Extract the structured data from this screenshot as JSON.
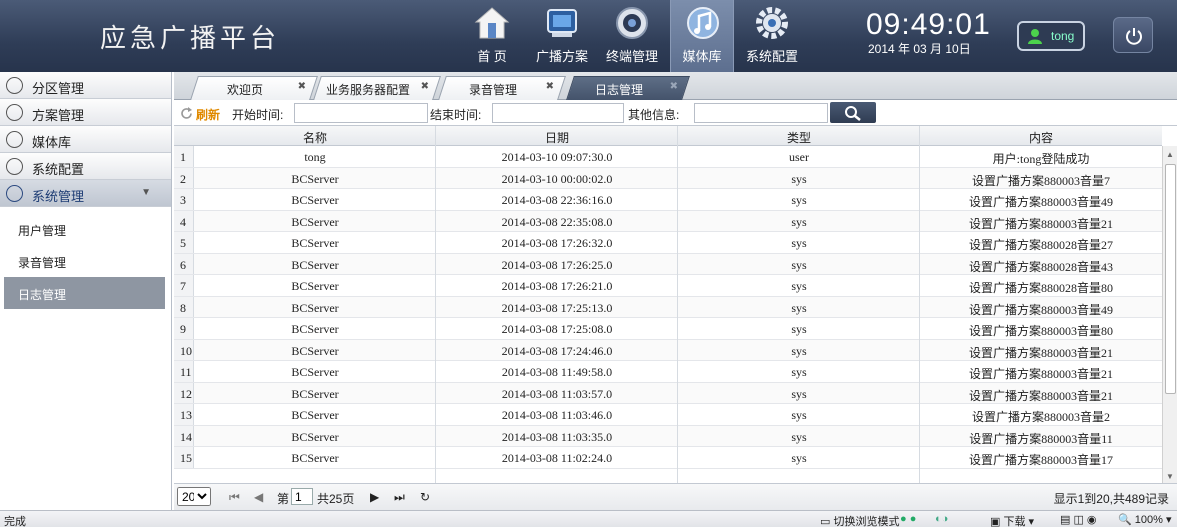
{
  "app": {
    "title": "应急广播平台"
  },
  "nav": [
    {
      "label": "首  页",
      "icon": "home-icon"
    },
    {
      "label": "广播方案",
      "icon": "broadcast-plan-icon"
    },
    {
      "label": "终端管理",
      "icon": "terminal-icon"
    },
    {
      "label": "媒体库",
      "icon": "media-library-icon",
      "active": true
    },
    {
      "label": "系统配置",
      "icon": "settings-gear-icon"
    }
  ],
  "clock": {
    "time": "09:49:01",
    "date": "2014 年 03 月 10日"
  },
  "user": {
    "name": "tong"
  },
  "sidebar": {
    "items": [
      {
        "label": "分区管理",
        "icon": "location-pin-icon"
      },
      {
        "label": "方案管理",
        "icon": "list-icon"
      },
      {
        "label": "媒体库",
        "icon": "media-icon"
      },
      {
        "label": "系统配置",
        "icon": "gear-icon"
      },
      {
        "label": "系统管理",
        "icon": "eye-icon",
        "open": true
      }
    ],
    "sub_items": [
      {
        "label": "用户管理"
      },
      {
        "label": "录音管理"
      },
      {
        "label": "日志管理",
        "active": true
      }
    ]
  },
  "tabs": [
    {
      "label": "欢迎页"
    },
    {
      "label": "业务服务器配置"
    },
    {
      "label": "录音管理"
    },
    {
      "label": "日志管理",
      "active": true
    }
  ],
  "search": {
    "refresh_label": "刷新",
    "start_label": "开始时间:",
    "end_label": "结束时间:",
    "other_label": "其他信息:",
    "start_value": "",
    "end_value": "",
    "other_value": ""
  },
  "grid": {
    "columns": [
      "名称",
      "日期",
      "类型",
      "内容"
    ],
    "rows": [
      [
        "1",
        "tong",
        "2014-03-10 09:07:30.0",
        "user",
        "用户:tong登陆成功"
      ],
      [
        "2",
        "BCServer",
        "2014-03-10 00:00:02.0",
        "sys",
        "设置广播方案880003音量7"
      ],
      [
        "3",
        "BCServer",
        "2014-03-08 22:36:16.0",
        "sys",
        "设置广播方案880003音量49"
      ],
      [
        "4",
        "BCServer",
        "2014-03-08 22:35:08.0",
        "sys",
        "设置广播方案880003音量21"
      ],
      [
        "5",
        "BCServer",
        "2014-03-08 17:26:32.0",
        "sys",
        "设置广播方案880028音量27"
      ],
      [
        "6",
        "BCServer",
        "2014-03-08 17:26:25.0",
        "sys",
        "设置广播方案880028音量43"
      ],
      [
        "7",
        "BCServer",
        "2014-03-08 17:26:21.0",
        "sys",
        "设置广播方案880028音量80"
      ],
      [
        "8",
        "BCServer",
        "2014-03-08 17:25:13.0",
        "sys",
        "设置广播方案880003音量49"
      ],
      [
        "9",
        "BCServer",
        "2014-03-08 17:25:08.0",
        "sys",
        "设置广播方案880003音量80"
      ],
      [
        "10",
        "BCServer",
        "2014-03-08 17:24:46.0",
        "sys",
        "设置广播方案880003音量21"
      ],
      [
        "11",
        "BCServer",
        "2014-03-08 11:49:58.0",
        "sys",
        "设置广播方案880003音量21"
      ],
      [
        "12",
        "BCServer",
        "2014-03-08 11:03:57.0",
        "sys",
        "设置广播方案880003音量21"
      ],
      [
        "13",
        "BCServer",
        "2014-03-08 11:03:46.0",
        "sys",
        "设置广播方案880003音量2"
      ],
      [
        "14",
        "BCServer",
        "2014-03-08 11:03:35.0",
        "sys",
        "设置广播方案880003音量11"
      ],
      [
        "15",
        "BCServer",
        "2014-03-08 11:02:24.0",
        "sys",
        "设置广播方案880003音量17"
      ]
    ]
  },
  "pager": {
    "page_size": "20",
    "page_prefix": "第",
    "page_value": "1",
    "page_suffix": "共25页",
    "summary": "显示1到20,共489记录"
  },
  "statusbar": {
    "left": "完成",
    "browse_mode": "切换浏览模式",
    "download": "下载",
    "zoom": "100%"
  }
}
